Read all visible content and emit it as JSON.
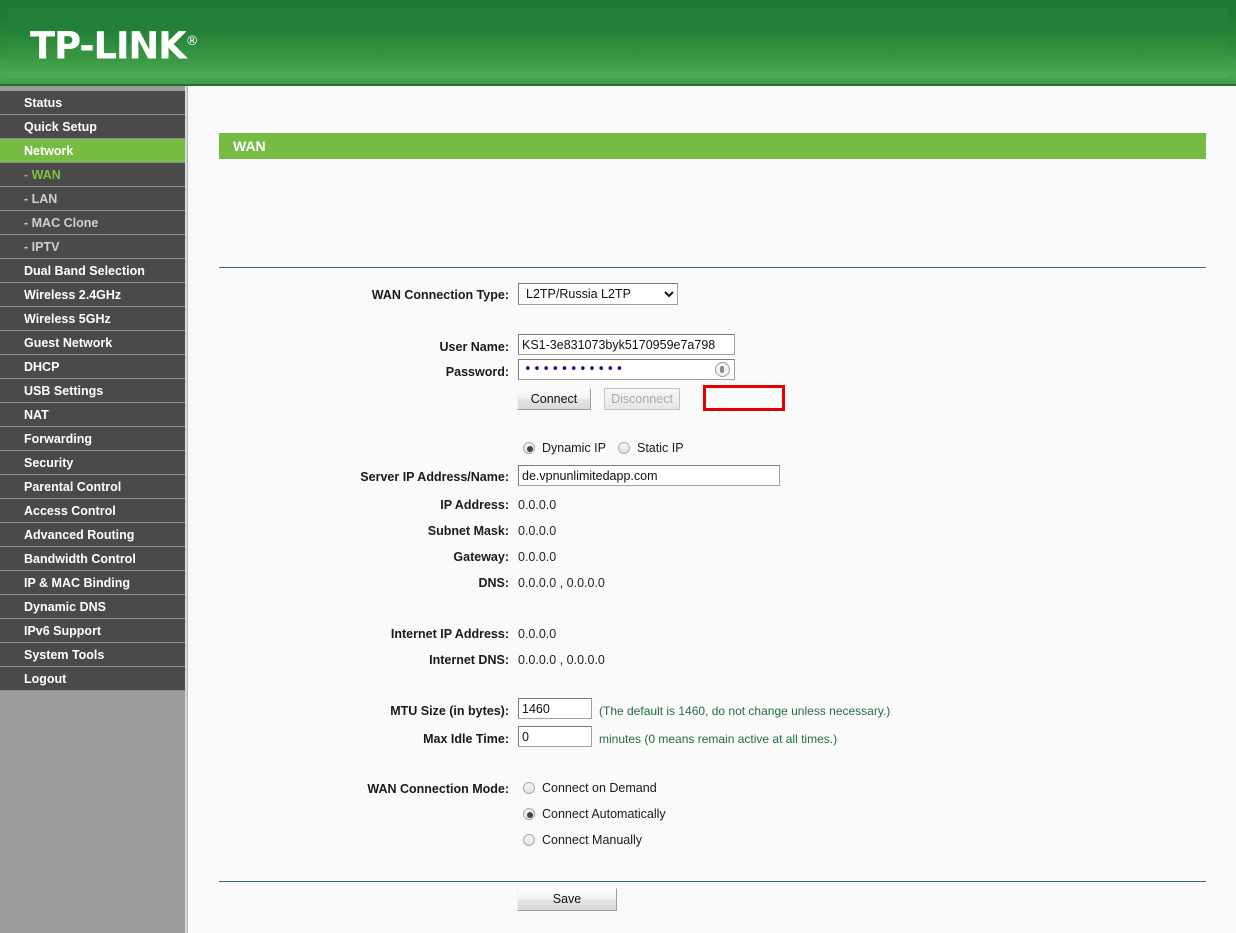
{
  "header": {
    "brand": "TP-LINK",
    "registered": "®"
  },
  "sidebar": {
    "items": [
      {
        "label": "Status",
        "type": "top",
        "state": "normal"
      },
      {
        "label": "Quick Setup",
        "type": "top",
        "state": "normal"
      },
      {
        "label": "Network",
        "type": "top",
        "state": "active-parent"
      },
      {
        "label": "- WAN",
        "type": "sub",
        "state": "active-sub"
      },
      {
        "label": "- LAN",
        "type": "sub",
        "state": "normal"
      },
      {
        "label": "- MAC Clone",
        "type": "sub",
        "state": "normal"
      },
      {
        "label": "- IPTV",
        "type": "sub",
        "state": "normal"
      },
      {
        "label": "Dual Band Selection",
        "type": "top",
        "state": "normal"
      },
      {
        "label": "Wireless 2.4GHz",
        "type": "top",
        "state": "normal"
      },
      {
        "label": "Wireless 5GHz",
        "type": "top",
        "state": "normal"
      },
      {
        "label": "Guest Network",
        "type": "top",
        "state": "normal"
      },
      {
        "label": "DHCP",
        "type": "top",
        "state": "normal"
      },
      {
        "label": "USB Settings",
        "type": "top",
        "state": "normal"
      },
      {
        "label": "NAT",
        "type": "top",
        "state": "normal"
      },
      {
        "label": "Forwarding",
        "type": "top",
        "state": "normal"
      },
      {
        "label": "Security",
        "type": "top",
        "state": "normal"
      },
      {
        "label": "Parental Control",
        "type": "top",
        "state": "normal"
      },
      {
        "label": "Access Control",
        "type": "top",
        "state": "normal"
      },
      {
        "label": "Advanced Routing",
        "type": "top",
        "state": "normal"
      },
      {
        "label": "Bandwidth Control",
        "type": "top",
        "state": "normal"
      },
      {
        "label": "IP & MAC Binding",
        "type": "top",
        "state": "normal"
      },
      {
        "label": "Dynamic DNS",
        "type": "top",
        "state": "normal"
      },
      {
        "label": "IPv6 Support",
        "type": "top",
        "state": "normal"
      },
      {
        "label": "System Tools",
        "type": "top",
        "state": "normal"
      },
      {
        "label": "Logout",
        "type": "top",
        "state": "normal"
      }
    ]
  },
  "page": {
    "banner_title": "WAN",
    "connection_type": {
      "label": "WAN Connection Type:",
      "selected": "L2TP/Russia L2TP"
    },
    "credentials": {
      "username_label": "User Name:",
      "username_value": "KS1-3e831073byk5170959e7a798",
      "password_label": "Password:",
      "password_dots": "•••••••••••",
      "connect_button": "Connect",
      "disconnect_button": "Disconnect"
    },
    "ip_mode": {
      "dynamic_label": "Dynamic IP",
      "static_label": "Static IP",
      "selected": "Dynamic IP"
    },
    "server": {
      "label": "Server IP Address/Name:",
      "value": "de.vpnunlimitedapp.com"
    },
    "status_rows": [
      {
        "label": "IP Address:",
        "value": "0.0.0.0"
      },
      {
        "label": "Subnet Mask:",
        "value": "0.0.0.0"
      },
      {
        "label": "Gateway:",
        "value": "0.0.0.0"
      },
      {
        "label": "DNS:",
        "value": "0.0.0.0 , 0.0.0.0"
      }
    ],
    "internet_rows": [
      {
        "label": "Internet IP Address:",
        "value": "0.0.0.0"
      },
      {
        "label": "Internet DNS:",
        "value": "0.0.0.0 , 0.0.0.0"
      }
    ],
    "mtu": {
      "label": "MTU Size (in bytes):",
      "value": "1460",
      "hint": "(The default is 1460, do not change unless necessary.)"
    },
    "idle": {
      "label": "Max Idle Time:",
      "value": "0",
      "hint": "minutes (0 means remain active at all times.)"
    },
    "connection_mode": {
      "label": "WAN Connection Mode:",
      "options": [
        "Connect on Demand",
        "Connect Automatically",
        "Connect Manually"
      ],
      "selected": "Connect Automatically"
    },
    "save_button": "Save"
  },
  "colors": {
    "brand_green": "#76bc43",
    "header_green": "#24813a",
    "sidebar_dark": "#4a4a4a",
    "highlight_red": "#e50000",
    "hint_green": "#1f6f3d"
  }
}
